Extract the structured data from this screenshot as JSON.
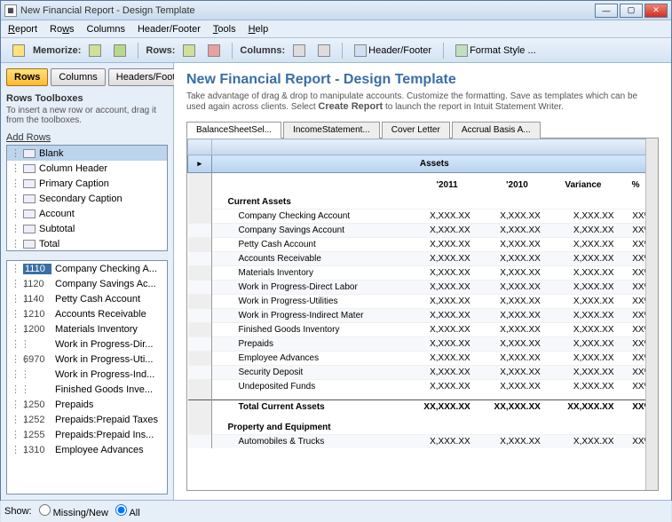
{
  "window": {
    "title": "New Financial Report - Design Template"
  },
  "menu": {
    "report": "Report",
    "rows": "Rows",
    "columns": "Columns",
    "headerfooter": "Header/Footer",
    "tools": "Tools",
    "help": "Help"
  },
  "toolbar": {
    "memorize": "Memorize:",
    "rows": "Rows:",
    "columns": "Columns:",
    "headerfooter": "Header/Footer",
    "format": "Format Style ..."
  },
  "left": {
    "tab_rows": "Rows",
    "tab_columns": "Columns",
    "tab_hf": "Headers/Footers",
    "toolboxes_title": "Rows Toolboxes",
    "toolboxes_desc": "To insert a new row or account, drag it from the toolboxes.",
    "addrows_label": "Add Rows",
    "types": [
      "Blank",
      "Column Header",
      "Primary Caption",
      "Secondary Caption",
      "Account",
      "Subtotal",
      "Total"
    ],
    "accts": [
      {
        "num": "1110",
        "name": "Company Checking A..."
      },
      {
        "num": "1120",
        "name": "Company Savings Ac..."
      },
      {
        "num": "1140",
        "name": "Petty Cash Account"
      },
      {
        "num": "1210",
        "name": "Accounts Receivable"
      },
      {
        "num": "1200",
        "name": "Materials Inventory"
      },
      {
        "num": "",
        "name": "Work in Progress-Dir..."
      },
      {
        "num": "6970",
        "name": "Work in Progress-Uti..."
      },
      {
        "num": "",
        "name": "Work in Progress-Ind..."
      },
      {
        "num": "",
        "name": "Finished Goods Inve..."
      },
      {
        "num": "1250",
        "name": "Prepaids"
      },
      {
        "num": "1252",
        "name": "Prepaids:Prepaid Taxes"
      },
      {
        "num": "1255",
        "name": "Prepaids:Prepaid Ins..."
      },
      {
        "num": "1310",
        "name": "Employee Advances"
      }
    ],
    "show": "Show:",
    "missing": "Missing/New",
    "all": "All"
  },
  "right": {
    "title": "New Financial Report - Design Template",
    "desc": "Take advantage of drag & drop to manipulate accounts. Customize the formatting. Save as templates which can be used again across clients. Select Create Report to launch the report in Intuit Statement Writer.",
    "tabs": [
      "BalanceSheetSel...",
      "IncomeStatement...",
      "Cover Letter",
      "Accrual Basis A..."
    ],
    "assets": "Assets",
    "cols": {
      "y1": "'2011",
      "y2": "'2010",
      "var": "Variance",
      "pct": "%"
    },
    "sect_curr": "Current Assets",
    "rows": [
      "Company Checking Account",
      "Company Savings Account",
      "Petty Cash Account",
      "Accounts Receivable",
      "Materials Inventory",
      "Work in Progress-Direct Labor",
      "Work in Progress-Utilities",
      "Work in Progress-Indirect Mater",
      "Finished Goods Inventory",
      "Prepaids",
      "Employee Advances",
      "Security Deposit",
      "Undeposited Funds"
    ],
    "val": "X,XXX.XX",
    "valpct": "XX%",
    "total_curr": "Total Current Assets",
    "tval": "XX,XXX.XX",
    "sect_pe": "Property and Equipment",
    "row_pe1": "Automobiles & Trucks"
  }
}
